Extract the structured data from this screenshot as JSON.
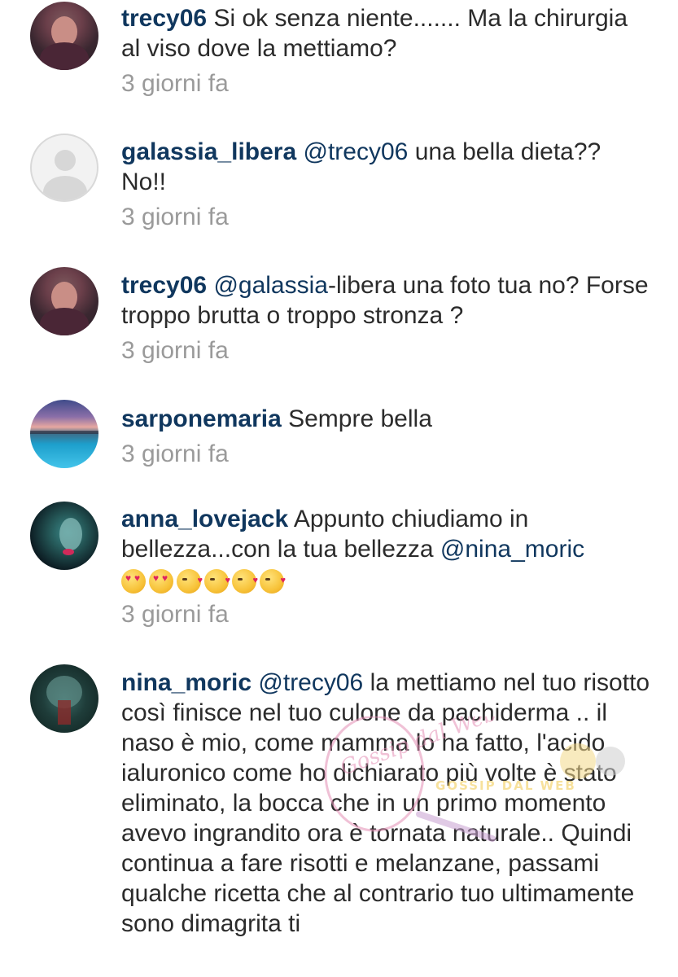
{
  "comments": [
    {
      "username": "trecy06",
      "mention": "",
      "text": "Si ok senza niente....... Ma la chirurgia al viso dove la mettiamo?",
      "time": "3 giorni fa"
    },
    {
      "username": "galassia_libera",
      "mention": "@trecy06",
      "text": "una bella dieta?? No!!",
      "time": "3 giorni fa"
    },
    {
      "username": "trecy06",
      "mention": "@galassia",
      "text": "-libera una foto tua no? Forse troppo brutta o troppo stronza ?",
      "time": "3 giorni fa"
    },
    {
      "username": "sarponemaria",
      "mention": "",
      "text": "Sempre bella",
      "time": "3 giorni fa"
    },
    {
      "username": "anna_lovejack",
      "mention": "",
      "text": "Appunto chiudiamo in bellezza...con la tua bellezza",
      "mention_after": "@nina_moric",
      "emojis": [
        "heart-eyes-emoji",
        "heart-eyes-emoji",
        "kiss-emoji",
        "kiss-emoji",
        "kiss-emoji",
        "kiss-emoji"
      ],
      "time": "3 giorni fa"
    },
    {
      "username": "nina_moric",
      "mention": "@trecy06",
      "text": "la mettiamo nel tuo risotto così finisce nel tuo culone da pachiderma .. il naso è mio, come mamma lo ha fatto, l'acido ialuronico come ho dichiarato più volte è stato eliminato, la bocca che in un primo momento avevo ingrandito ora è tornata naturale.. Quindi continua a fare risotti e melanzane, passami qualche ricetta che al contrario tuo ultimamente sono dimagrita ti",
      "time": ""
    }
  ],
  "watermark": {
    "left_text": "Gossip dal Web",
    "right_text": "GOSSIP DAL WEB"
  },
  "colors": {
    "username": "#10375e",
    "text": "#2b2b2b",
    "time": "#9a9a9a"
  }
}
